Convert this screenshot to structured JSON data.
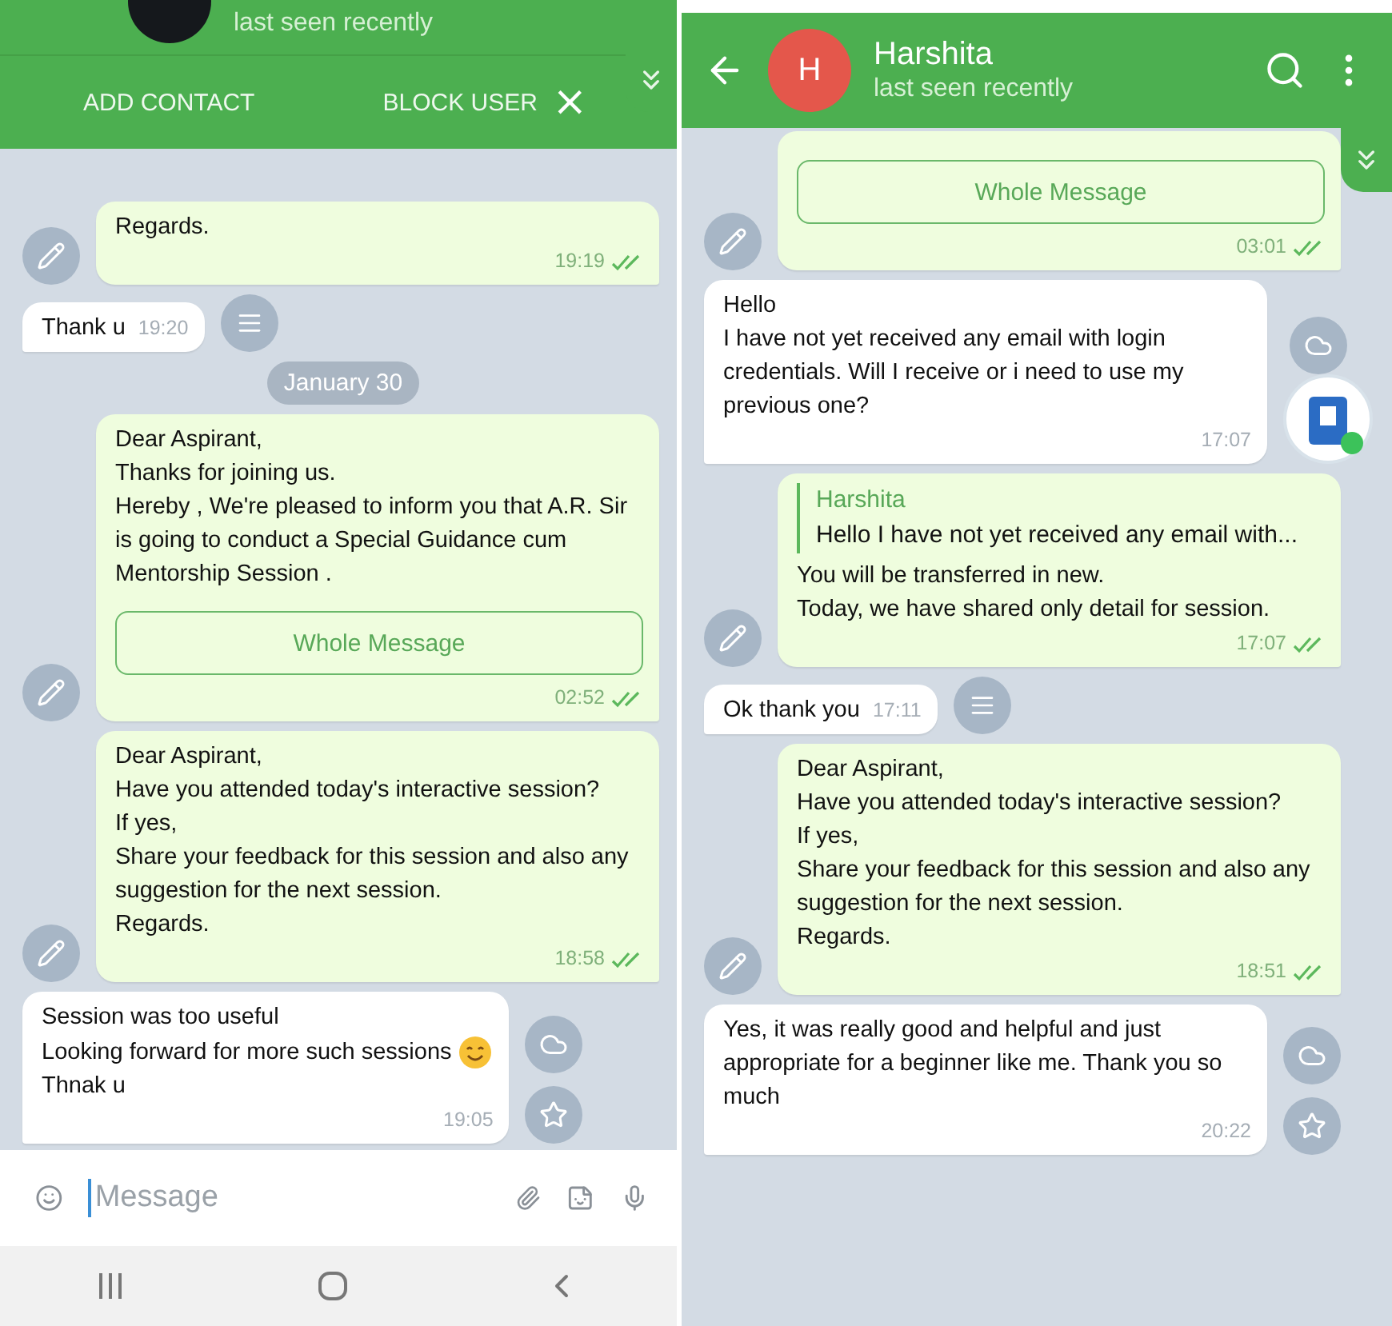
{
  "panels": [
    {
      "header": {
        "avatar": {
          "kind": "photo"
        },
        "status": "last seen recently"
      },
      "action_bar": {
        "buttons": [
          "ADD CONTACT",
          "BLOCK USER"
        ],
        "close": "×"
      },
      "scroll_down_button": true,
      "messages": [
        {
          "kind": "out",
          "lines": [
            "Regards."
          ],
          "time": "19:19",
          "read": true,
          "side_icons": [
            {
              "kind": "edit"
            }
          ]
        },
        {
          "kind": "in",
          "lines": [
            "Thank u"
          ],
          "time": "19:20",
          "side_icons": [
            {
              "kind": "menu"
            }
          ]
        },
        {
          "kind": "date",
          "text": "January 30"
        },
        {
          "kind": "out",
          "lines": [
            "Dear Aspirant,",
            "Thanks for joining us.",
            "Hereby , We're pleased to inform you that A.R. Sir is going to conduct a Special Guidance cum Mentorship Session ."
          ],
          "button": "Whole Message",
          "time": "02:52",
          "read": true,
          "side_icons": [
            {
              "kind": "edit"
            }
          ]
        },
        {
          "kind": "out",
          "lines": [
            "Dear Aspirant,",
            "Have you attended today's interactive session?",
            "If yes,",
            "Share your feedback for this session and also any suggestion for the next session.",
            "Regards."
          ],
          "time": "18:58",
          "read": true,
          "side_icons": [
            {
              "kind": "edit"
            }
          ]
        },
        {
          "kind": "in",
          "lines": [
            "Session was too useful",
            {
              "kind": "smile_emoji",
              "text": "Looking forward for more such sessions"
            },
            "Thnak u"
          ],
          "time": "19:05",
          "side_icons": [
            {
              "kind": "cloud"
            },
            {
              "kind": "star"
            }
          ]
        }
      ],
      "composer": {
        "placeholder": "Message"
      },
      "nav_bar": true
    },
    {
      "header": {
        "avatar": {
          "kind": "letter",
          "letter": "H"
        },
        "name": "Harshita",
        "status": "last seen recently"
      },
      "scroll_down_button": true,
      "messages": [
        {
          "kind": "out",
          "button": "Whole Message",
          "time": "03:01",
          "read": true,
          "side_icons": [
            {
              "kind": "edit"
            }
          ]
        },
        {
          "kind": "in",
          "lines": [
            "Hello",
            "I have not yet received any email with login credentials. Will I receive or i need to use my previous one?"
          ],
          "time": "17:07",
          "side_icons": [
            {
              "kind": "cloud"
            }
          ],
          "chat_head": true
        },
        {
          "kind": "out",
          "quote": {
            "name": "Harshita",
            "text": "Hello I have not yet received any email with..."
          },
          "lines": [
            "You will be transferred in new.",
            "Today, we have shared only detail for session."
          ],
          "time": "17:07",
          "read": true,
          "side_icons": [
            {
              "kind": "edit"
            }
          ]
        },
        {
          "kind": "in",
          "lines": [
            "Ok thank you"
          ],
          "time": "17:11",
          "side_icons": [
            {
              "kind": "menu"
            }
          ]
        },
        {
          "kind": "out",
          "lines": [
            "Dear Aspirant,",
            "Have you attended today's interactive session?",
            "If yes,",
            "Share your feedback for this session and also any suggestion for the next session.",
            "Regards."
          ],
          "time": "18:51",
          "read": true,
          "side_icons": [
            {
              "kind": "edit"
            }
          ]
        },
        {
          "kind": "in",
          "lines": [
            "Yes, it was really good and helpful and just appropriate for a beginner like me. Thank you so much"
          ],
          "time": "20:22",
          "side_icons": [
            {
              "kind": "cloud"
            },
            {
              "kind": "star"
            }
          ]
        }
      ]
    }
  ]
}
